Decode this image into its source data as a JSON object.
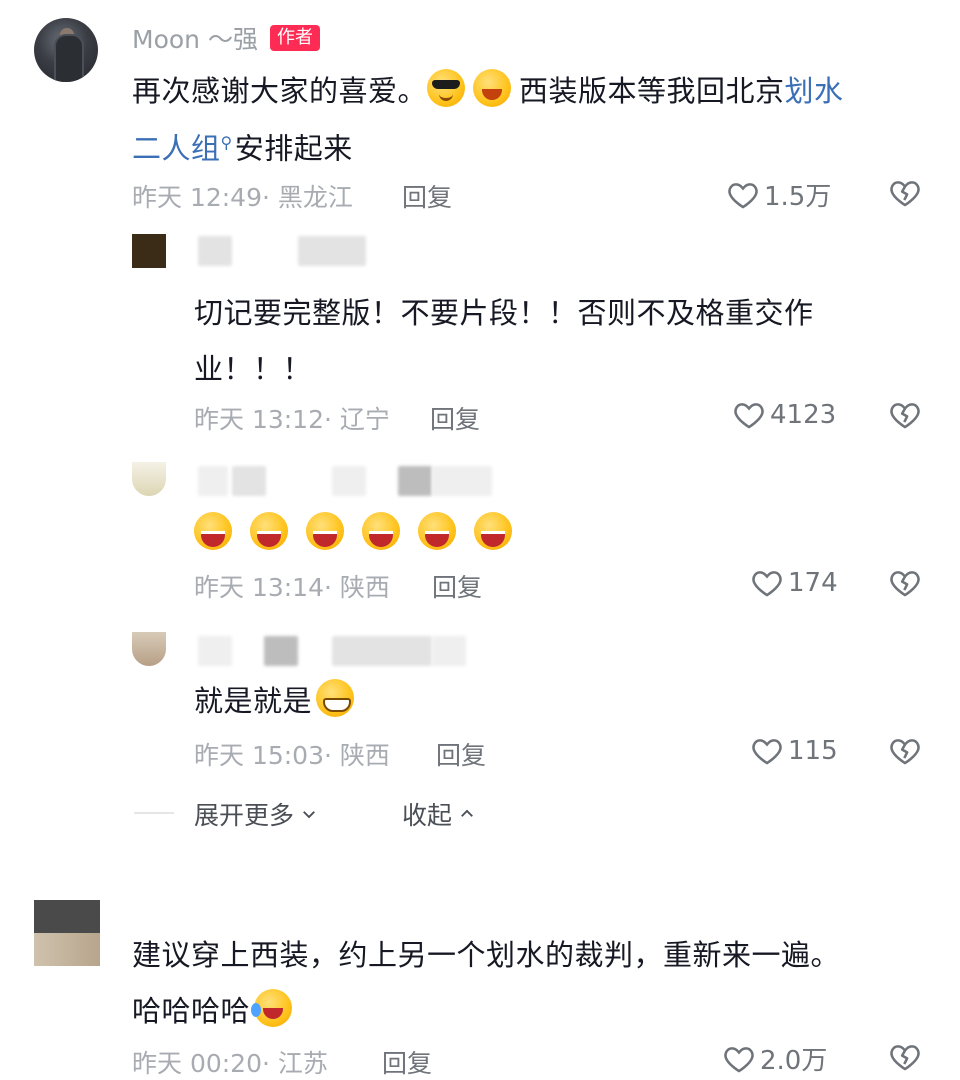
{
  "main_comment": {
    "author": "Moon ～强",
    "badge": "作者",
    "text_part1": "再次感谢大家的喜爱。",
    "text_part2": "西装版本等我回北京",
    "link_text_1": "划水",
    "link_text_2": "二人组",
    "text_part3": "安排起来",
    "emojis": [
      "cool-sunglasses-emoji",
      "wink-laugh-emoji"
    ],
    "time": "昨天 12:49",
    "location": "黑龙江",
    "reply_label": "回复",
    "likes": "1.5万"
  },
  "replies": [
    {
      "text_line1": "切记要完整版！不要片段！！否则不及格重交作",
      "text_line2": "业！！！",
      "time": "昨天 13:12",
      "location": "辽宁",
      "reply_label": "回复",
      "likes": "4123"
    },
    {
      "emoji_count": 6,
      "emoji": "laughing-squint-emoji",
      "time": "昨天 13:14",
      "location": "陕西",
      "reply_label": "回复",
      "likes": "174"
    },
    {
      "text": "就是就是",
      "emoji": "grin-emoji",
      "time": "昨天 15:03",
      "location": "陕西",
      "reply_label": "回复",
      "likes": "115"
    }
  ],
  "thread_controls": {
    "expand_more": "展开更多",
    "collapse": "收起"
  },
  "second_comment": {
    "text_line1": "建议穿上西装，约上另一个划水的裁判，重新来一遍。",
    "text_line2": "哈哈哈哈",
    "emoji": "tears-of-joy-emoji",
    "time": "昨天 00:20",
    "location": "江苏",
    "reply_label": "回复",
    "likes": "2.0万"
  },
  "colors": {
    "badge": "#fe2c55",
    "link": "#3b6fb6",
    "meta": "#a8acb2",
    "text": "#161823"
  }
}
